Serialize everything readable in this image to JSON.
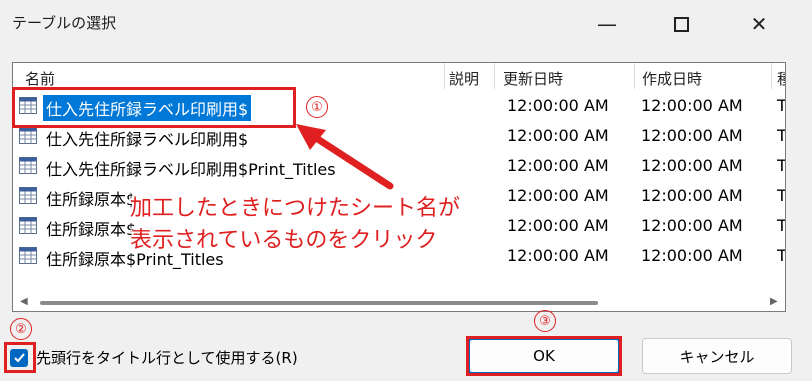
{
  "window": {
    "title": "テーブルの選択",
    "minimize_glyph": "—",
    "close_glyph": "✕"
  },
  "list": {
    "columns": [
      "名前",
      "説明",
      "更新日時",
      "作成日時",
      "種"
    ],
    "rows": [
      {
        "name": "仕入先住所録ラベル印刷用$",
        "modified": "12:00:00 AM",
        "created": "12:00:00 AM",
        "type": "T",
        "selected": true
      },
      {
        "name": "仕入先住所録ラベル印刷用$",
        "modified": "12:00:00 AM",
        "created": "12:00:00 AM",
        "type": "T",
        "selected": false
      },
      {
        "name": "仕入先住所録ラベル印刷用$Print_Titles",
        "modified": "12:00:00 AM",
        "created": "12:00:00 AM",
        "type": "T",
        "selected": false
      },
      {
        "name": "住所録原本$",
        "modified": "12:00:00 AM",
        "created": "12:00:00 AM",
        "type": "T",
        "selected": false
      },
      {
        "name": "住所録原本$",
        "modified": "12:00:00 AM",
        "created": "12:00:00 AM",
        "type": "T",
        "selected": false
      },
      {
        "name": "住所録原本$Print_Titles",
        "modified": "12:00:00 AM",
        "created": "12:00:00 AM",
        "type": "T",
        "selected": false
      }
    ]
  },
  "checkbox": {
    "label": "先頭行をタイトル行として使用する(R)",
    "checked": true
  },
  "buttons": {
    "ok": "OK",
    "cancel": "キャンセル"
  },
  "annotation": {
    "line1": "加工したときにつけたシート名が",
    "line2": "表示されているものをクリック",
    "step1": "①",
    "step2": "②",
    "step3": "③",
    "color": "#e02020"
  }
}
